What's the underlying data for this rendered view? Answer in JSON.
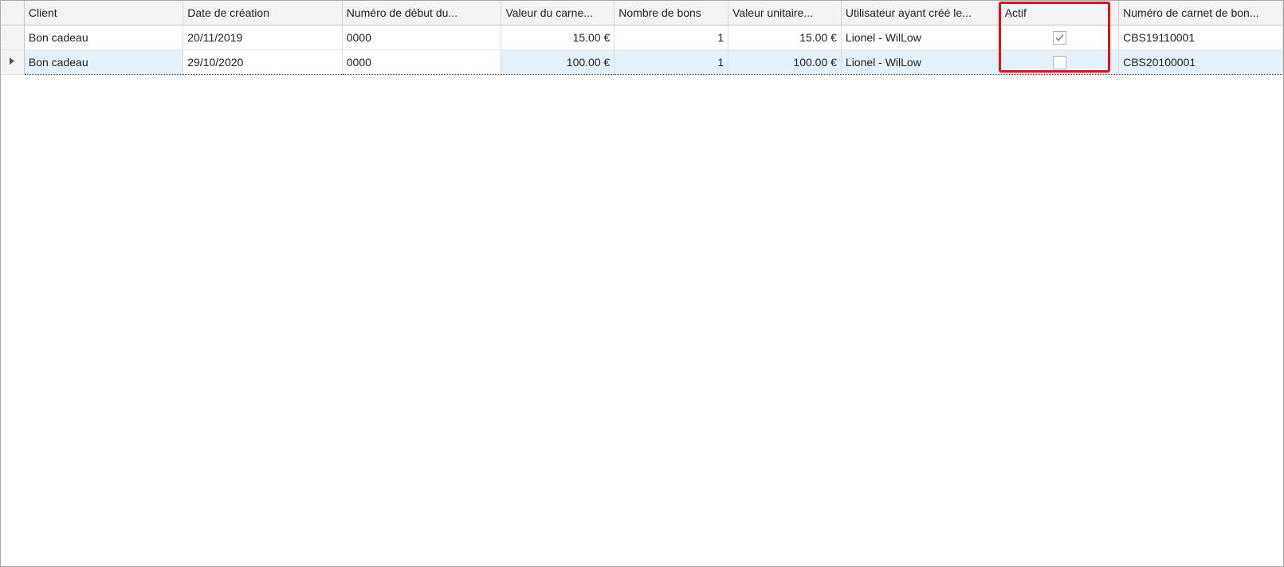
{
  "columns": [
    "Client",
    "Date de création",
    "Numéro de début du...",
    "Valeur du carne...",
    "Nombre de bons",
    "Valeur unitaire...",
    "Utilisateur ayant créé le...",
    "Actif",
    "Numéro de carnet de bon..."
  ],
  "rows": [
    {
      "client": "Bon cadeau",
      "date": "20/11/2019",
      "start_number": "0000",
      "book_value": "15.00 €",
      "voucher_count": "1",
      "unit_value": "15.00 €",
      "created_by": "Lionel - WilLow",
      "active": true,
      "book_number": "CBS19110001"
    },
    {
      "client": "Bon cadeau",
      "date": "29/10/2020",
      "start_number": "0000",
      "book_value": "100.00 €",
      "voucher_count": "1",
      "unit_value": "100.00 €",
      "created_by": "Lionel - WilLow",
      "active": false,
      "book_number": "CBS20100001"
    }
  ],
  "row_indicator_icon": "current-row-arrow-icon",
  "highlight_color": "#e0111b",
  "selected_row_color": "#e4f1fb"
}
